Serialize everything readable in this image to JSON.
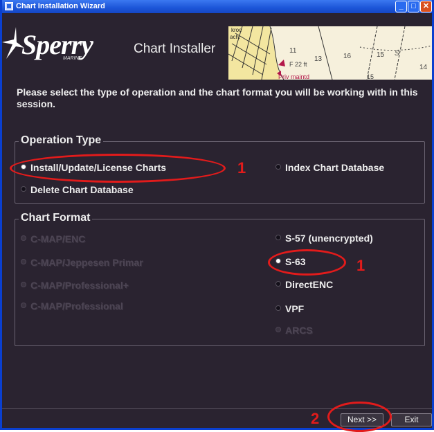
{
  "window": {
    "title": "Chart Installation Wizard",
    "controls": {
      "minimize": "_",
      "maximize": "□",
      "close": "✕"
    }
  },
  "header": {
    "logo_text": "Sperry",
    "logo_subtext": "MARINE",
    "installer_label": "Chart Installer",
    "map_labels": [
      "kroc",
      "ach.",
      "11",
      "13",
      "16",
      "15",
      "S",
      "F 22 ft",
      "Priv maintd",
      "15",
      "14"
    ]
  },
  "intro_text": "Please select the type of operation and the chart format you will be working with in this session.",
  "operation_type": {
    "title": "Operation Type",
    "options": [
      {
        "label": "Install/Update/License Charts",
        "selected": true,
        "enabled": true
      },
      {
        "label": "Index Chart Database",
        "selected": false,
        "enabled": true
      },
      {
        "label": "Delete Chart Database",
        "selected": false,
        "enabled": true
      }
    ]
  },
  "chart_format": {
    "title": "Chart Format",
    "left_options": [
      {
        "label": "C-MAP/ENC",
        "enabled": false
      },
      {
        "label": "C-MAP/Jeppesen Primar",
        "enabled": false
      },
      {
        "label": "C-MAP/Professional+",
        "enabled": false
      },
      {
        "label": "C-MAP/Professional",
        "enabled": false
      }
    ],
    "right_options": [
      {
        "label": "S-57 (unencrypted)",
        "selected": false,
        "enabled": true
      },
      {
        "label": "S-63",
        "selected": true,
        "enabled": true
      },
      {
        "label": "DirectENC",
        "selected": false,
        "enabled": true
      },
      {
        "label": "VPF",
        "selected": false,
        "enabled": true
      },
      {
        "label": "ARCS",
        "selected": false,
        "enabled": false
      }
    ]
  },
  "footer": {
    "next_label": "Next >>",
    "exit_label": "Exit"
  },
  "annotations": {
    "step1_operation": "1",
    "step1_format": "1",
    "step2_next": "2",
    "color": "#e21b1b"
  }
}
